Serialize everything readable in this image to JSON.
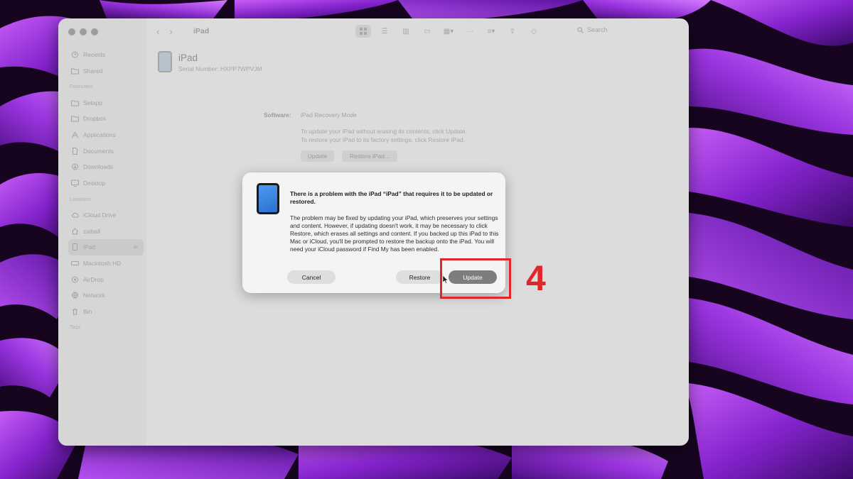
{
  "sidebar": {
    "sections": [
      {
        "title": "",
        "items": [
          {
            "label": "Recents",
            "icon": "clock-icon"
          },
          {
            "label": "Shared",
            "icon": "shared-folder-icon"
          }
        ]
      },
      {
        "title": "Favourites",
        "items": [
          {
            "label": "Setapp",
            "icon": "folder-icon"
          },
          {
            "label": "Dropbox",
            "icon": "folder-icon"
          },
          {
            "label": "Applications",
            "icon": "applications-icon"
          },
          {
            "label": "Documents",
            "icon": "document-icon"
          },
          {
            "label": "Downloads",
            "icon": "download-icon"
          },
          {
            "label": "Desktop",
            "icon": "desktop-icon"
          }
        ]
      },
      {
        "title": "Locations",
        "items": [
          {
            "label": "iCloud Drive",
            "icon": "cloud-icon"
          },
          {
            "label": "zaiball",
            "icon": "home-icon"
          },
          {
            "label": "iPad",
            "icon": "ipad-icon",
            "active": true
          },
          {
            "label": "Macintosh HD",
            "icon": "disk-icon"
          },
          {
            "label": "AirDrop",
            "icon": "airdrop-icon"
          },
          {
            "label": "Network",
            "icon": "network-icon"
          },
          {
            "label": "Bin",
            "icon": "trash-icon"
          }
        ]
      },
      {
        "title": "Tags",
        "items": []
      }
    ]
  },
  "toolbar": {
    "title": "iPad",
    "search_label": "Search"
  },
  "device": {
    "name": "iPad",
    "serial": "Serial Number: HXPP7WPVJM"
  },
  "software": {
    "label": "Software:",
    "value": "iPad Recovery Mode",
    "line1": "To update your iPad without erasing its contents, click Update.",
    "line2": "To restore your iPad to its factory settings, click Restore iPad.",
    "update_label": "Update",
    "restore_label": "Restore iPad..."
  },
  "dialog": {
    "title": "There is a problem with the iPad “iPad” that requires it to be updated or restored.",
    "body": "The problem may be fixed by updating your iPad, which preserves your settings and content. However, if updating doesn't work, it may be necessary to click Restore, which erases all settings and content. If you backed up this iPad to this Mac or iCloud, you'll be prompted to restore the backup onto the iPad. You will need your iCloud password if Find My has been enabled.",
    "cancel_label": "Cancel",
    "restore_label": "Restore",
    "update_label": "Update"
  },
  "annotation": {
    "step_number": "4",
    "color": "#e0262a"
  },
  "colors": {
    "wallpaper_purple": "#8e2bd6",
    "dialog_bg": "#f4f4f4"
  }
}
